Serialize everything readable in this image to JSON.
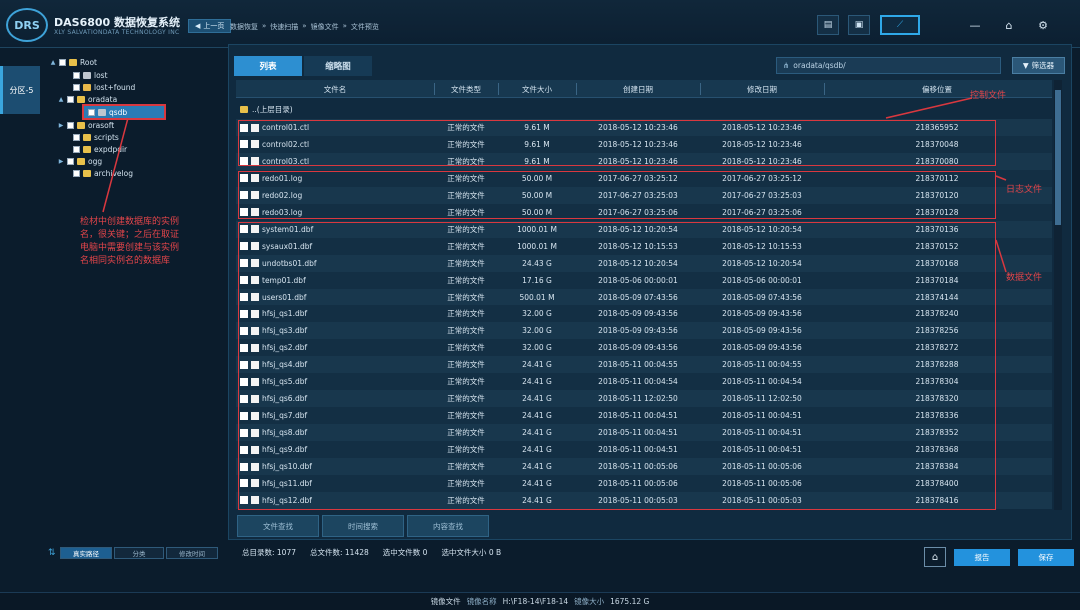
{
  "app": {
    "logo_text": "DRS",
    "brand": "DAS6800 数据恢复系统",
    "brand_sub": "XLY SALVATIONDATA TECHNOLOGY INC",
    "back_label": "上一页",
    "breadcrumbs": [
      "数据恢复",
      "快速扫描",
      "镜像文件",
      "文件预览"
    ]
  },
  "sidebar": {
    "partition_tab": "分区-5"
  },
  "tree": {
    "items": [
      {
        "label": "Root",
        "level": 0,
        "twisty": "▲",
        "icon": "folder"
      },
      {
        "label": "lost",
        "level": 1,
        "twisty": "",
        "icon": "folder-gray"
      },
      {
        "label": "lost+found",
        "level": 1,
        "twisty": "",
        "icon": "folder-lock"
      },
      {
        "label": "oradata",
        "level": 1,
        "twisty": "▲",
        "icon": "folder"
      },
      {
        "label": "qsdb",
        "level": 2,
        "twisty": "",
        "icon": "folder-gray"
      },
      {
        "label": "orasoft",
        "level": 1,
        "twisty": "▶",
        "icon": "folder"
      },
      {
        "label": "scripts",
        "level": 1,
        "twisty": "",
        "icon": "folder"
      },
      {
        "label": "expdpdir",
        "level": 1,
        "twisty": "",
        "icon": "folder"
      },
      {
        "label": "ogg",
        "level": 1,
        "twisty": "▶",
        "icon": "folder"
      },
      {
        "label": "archivelog",
        "level": 1,
        "twisty": "",
        "icon": "folder"
      }
    ],
    "footer": [
      "真实路径",
      "分类",
      "修改时间"
    ]
  },
  "annotations": {
    "tree_note": "检材中创建数据库的实例名，很关键；之后在取证电脑中需要创建与该实例名相同实例名的数据库",
    "control": "控制文件",
    "log": "日志文件",
    "data": "数据文件"
  },
  "main": {
    "tabs": [
      "列表",
      "缩略图"
    ],
    "path": "oradata/qsdb/",
    "filter_label": "筛选器",
    "columns": [
      "文件名",
      "文件类型",
      "文件大小",
      "创建日期",
      "修改日期",
      "偏移位置"
    ],
    "parent_label": "..(上层目录)",
    "rows": [
      {
        "name": "control01.ctl",
        "type": "正常的文件",
        "size": "9.61 M",
        "created": "2018-05-12 10:23:46",
        "modified": "2018-05-12 10:23:46",
        "offset": "218365952"
      },
      {
        "name": "control02.ctl",
        "type": "正常的文件",
        "size": "9.61 M",
        "created": "2018-05-12 10:23:46",
        "modified": "2018-05-12 10:23:46",
        "offset": "218370048"
      },
      {
        "name": "control03.ctl",
        "type": "正常的文件",
        "size": "9.61 M",
        "created": "2018-05-12 10:23:46",
        "modified": "2018-05-12 10:23:46",
        "offset": "218370080"
      },
      {
        "name": "redo01.log",
        "type": "正常的文件",
        "size": "50.00 M",
        "created": "2017-06-27 03:25:12",
        "modified": "2017-06-27 03:25:12",
        "offset": "218370112"
      },
      {
        "name": "redo02.log",
        "type": "正常的文件",
        "size": "50.00 M",
        "created": "2017-06-27 03:25:03",
        "modified": "2017-06-27 03:25:03",
        "offset": "218370120"
      },
      {
        "name": "redo03.log",
        "type": "正常的文件",
        "size": "50.00 M",
        "created": "2017-06-27 03:25:06",
        "modified": "2017-06-27 03:25:06",
        "offset": "218370128"
      },
      {
        "name": "system01.dbf",
        "type": "正常的文件",
        "size": "1000.01 M",
        "created": "2018-05-12 10:20:54",
        "modified": "2018-05-12 10:20:54",
        "offset": "218370136"
      },
      {
        "name": "sysaux01.dbf",
        "type": "正常的文件",
        "size": "1000.01 M",
        "created": "2018-05-12 10:15:53",
        "modified": "2018-05-12 10:15:53",
        "offset": "218370152"
      },
      {
        "name": "undotbs01.dbf",
        "type": "正常的文件",
        "size": "24.43 G",
        "created": "2018-05-12 10:20:54",
        "modified": "2018-05-12 10:20:54",
        "offset": "218370168"
      },
      {
        "name": "temp01.dbf",
        "type": "正常的文件",
        "size": "17.16 G",
        "created": "2018-05-06 00:00:01",
        "modified": "2018-05-06 00:00:01",
        "offset": "218370184"
      },
      {
        "name": "users01.dbf",
        "type": "正常的文件",
        "size": "500.01 M",
        "created": "2018-05-09 07:43:56",
        "modified": "2018-05-09 07:43:56",
        "offset": "218374144"
      },
      {
        "name": "hfsj_qs1.dbf",
        "type": "正常的文件",
        "size": "32.00 G",
        "created": "2018-05-09 09:43:56",
        "modified": "2018-05-09 09:43:56",
        "offset": "218378240"
      },
      {
        "name": "hfsj_qs3.dbf",
        "type": "正常的文件",
        "size": "32.00 G",
        "created": "2018-05-09 09:43:56",
        "modified": "2018-05-09 09:43:56",
        "offset": "218378256"
      },
      {
        "name": "hfsj_qs2.dbf",
        "type": "正常的文件",
        "size": "32.00 G",
        "created": "2018-05-09 09:43:56",
        "modified": "2018-05-09 09:43:56",
        "offset": "218378272"
      },
      {
        "name": "hfsj_qs4.dbf",
        "type": "正常的文件",
        "size": "24.41 G",
        "created": "2018-05-11 00:04:55",
        "modified": "2018-05-11 00:04:55",
        "offset": "218378288"
      },
      {
        "name": "hfsj_qs5.dbf",
        "type": "正常的文件",
        "size": "24.41 G",
        "created": "2018-05-11 00:04:54",
        "modified": "2018-05-11 00:04:54",
        "offset": "218378304"
      },
      {
        "name": "hfsj_qs6.dbf",
        "type": "正常的文件",
        "size": "24.41 G",
        "created": "2018-05-11 12:02:50",
        "modified": "2018-05-11 12:02:50",
        "offset": "218378320"
      },
      {
        "name": "hfsj_qs7.dbf",
        "type": "正常的文件",
        "size": "24.41 G",
        "created": "2018-05-11 00:04:51",
        "modified": "2018-05-11 00:04:51",
        "offset": "218378336"
      },
      {
        "name": "hfsj_qs8.dbf",
        "type": "正常的文件",
        "size": "24.41 G",
        "created": "2018-05-11 00:04:51",
        "modified": "2018-05-11 00:04:51",
        "offset": "218378352"
      },
      {
        "name": "hfsj_qs9.dbf",
        "type": "正常的文件",
        "size": "24.41 G",
        "created": "2018-05-11 00:04:51",
        "modified": "2018-05-11 00:04:51",
        "offset": "218378368"
      },
      {
        "name": "hfsj_qs10.dbf",
        "type": "正常的文件",
        "size": "24.41 G",
        "created": "2018-05-11 00:05:06",
        "modified": "2018-05-11 00:05:06",
        "offset": "218378384"
      },
      {
        "name": "hfsj_qs11.dbf",
        "type": "正常的文件",
        "size": "24.41 G",
        "created": "2018-05-11 00:05:06",
        "modified": "2018-05-11 00:05:06",
        "offset": "218378400"
      },
      {
        "name": "hfsj_qs12.dbf",
        "type": "正常的文件",
        "size": "24.41 G",
        "created": "2018-05-11 00:05:03",
        "modified": "2018-05-11 00:05:03",
        "offset": "218378416"
      }
    ],
    "search_tabs": [
      "文件查找",
      "时间搜索",
      "内容查找"
    ]
  },
  "stats": {
    "total_dirs": "总目录数: 1077",
    "total_files": "总文件数: 11428",
    "selected_files": "选中文件数 0",
    "selected_size": "选中文件大小 0 B"
  },
  "actions": {
    "report": "报告",
    "save": "保存"
  },
  "statusbar": {
    "image_file": "镜像文件",
    "name_label": "镜像名称",
    "name_value": "H:\\F18-14\\F18-14",
    "size_label": "镜像大小",
    "size_value": "1675.12 G"
  }
}
